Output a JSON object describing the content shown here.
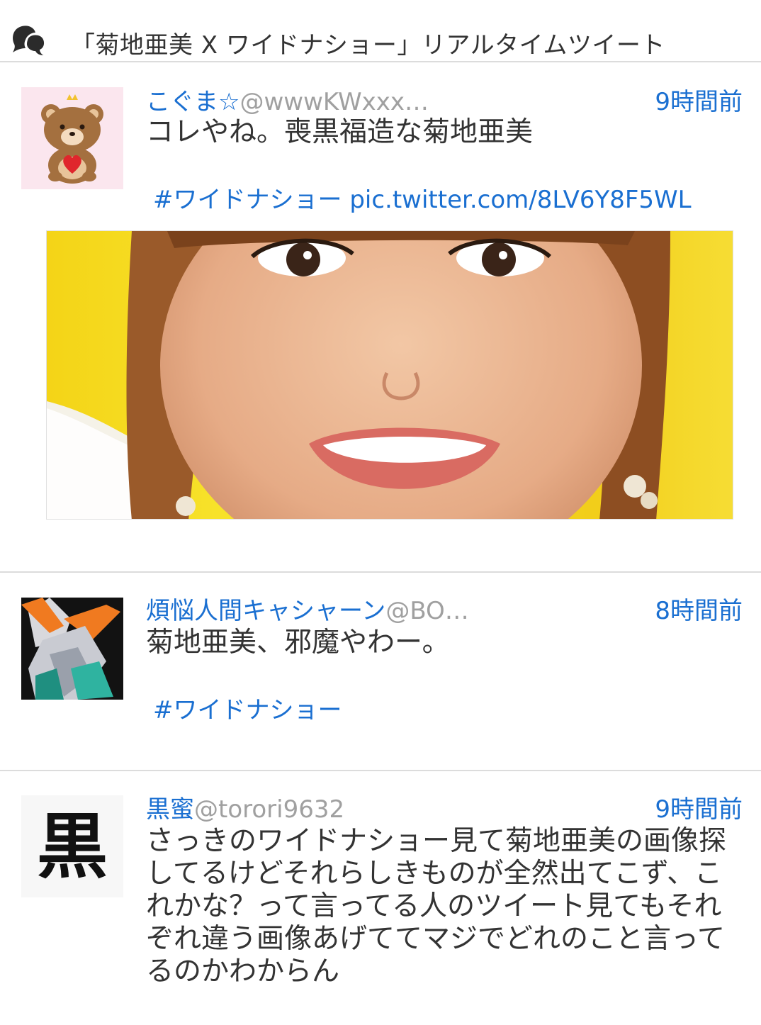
{
  "header": {
    "title": "「菊地亜美 X ワイドナショー」リアルタイムツイート",
    "icon": "speech-bubbles-icon"
  },
  "tweets": [
    {
      "name": "こぐま☆",
      "handle": "@wwwKWxxx…",
      "time": "9時間前",
      "text": "コレやね。喪黒福造な菊地亜美",
      "hashtag": "#ワイドナショー",
      "link": "pic.twitter.com/8LV6Y8F5WL",
      "avatar": "bear-avatar",
      "has_photo": true
    },
    {
      "name": "煩悩人間キャシャーン",
      "handle": "@BO…",
      "time": "8時間前",
      "text": "菊地亜美、邪魔やわー。",
      "hashtag": "#ワイドナショー",
      "avatar": "robot-avatar"
    },
    {
      "name": "黒蜜",
      "handle": "@torori9632",
      "time": "9時間前",
      "text": "さっきのワイドナショー見て菊地亜美の画像探してるけどそれらしきものが全然出てこず、これかな？って言ってる人のツイート見てもそれぞれ違う画像あげててマジでどれのこと言ってるのかわからん",
      "avatar_char": "黒",
      "avatar": "kanji-avatar"
    }
  ],
  "colors": {
    "link": "#1a6fd1",
    "handle": "#a0a0a0",
    "text": "#333333",
    "separator": "#dcdcdc"
  }
}
